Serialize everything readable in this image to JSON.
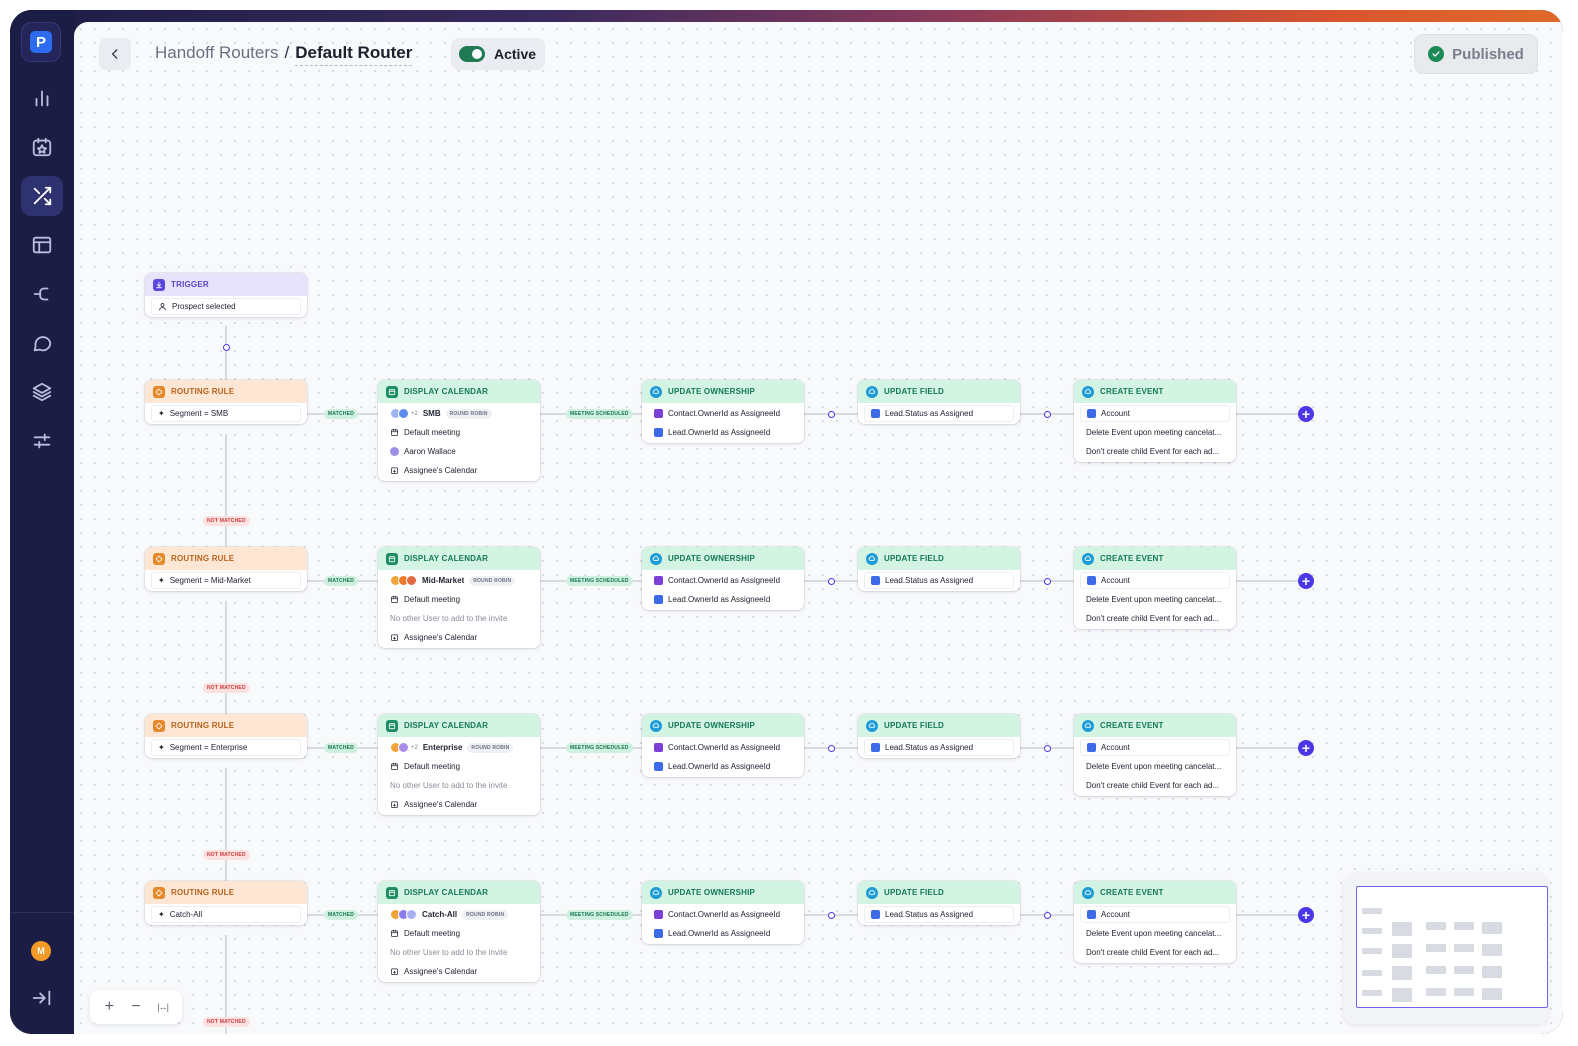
{
  "colors": {
    "sidebar_bg": "#1c1d44",
    "accent": "#4b37e8",
    "trigger_header": "#e7e3fb",
    "rule_header": "#fde7d4",
    "step_header": "#d3f3e3",
    "matched_badge": "#cdf0df",
    "not_matched_badge": "#fde0e0",
    "toggle_on": "#1f7a54"
  },
  "sidebar": {
    "logo": "P",
    "items": [
      {
        "icon": "bar-chart-icon"
      },
      {
        "icon": "calendar-star-icon"
      },
      {
        "icon": "shuffle-icon",
        "active": true
      },
      {
        "icon": "layout-icon"
      },
      {
        "icon": "branch-icon"
      },
      {
        "icon": "chat-icon"
      },
      {
        "icon": "layers-icon"
      },
      {
        "icon": "sliders-icon"
      }
    ],
    "avatar_initial": "M",
    "collapse_icon": "collapse-right-icon"
  },
  "header": {
    "breadcrumb_parent": "Handoff Routers",
    "breadcrumb_separator": "/",
    "breadcrumb_current": "Default Router",
    "status_label": "Active",
    "publish_label": "Published"
  },
  "labels": {
    "trigger_title": "TRIGGER",
    "trigger_value": "Prospect selected",
    "routing_rule": "ROUTING RULE",
    "display_calendar": "DISPLAY CALENDAR",
    "update_ownership": "UPDATE OWNERSHIP",
    "update_field": "UPDATE FIELD",
    "create_event": "CREATE EVENT",
    "matched": "MATCHED",
    "not_matched": "NOT MATCHED",
    "meeting_scheduled": "MEETING SCHEDULED",
    "round_robin": "ROUND ROBIN",
    "default_meeting": "Default meeting",
    "assignees_calendar": "Assignee's Calendar",
    "no_other_user": "No other User to add to the invite",
    "contact_owner": "Contact.OwnerId as AssigneeId",
    "lead_owner": "Lead.OwnerId as AssigneeId",
    "lead_status": "Lead.Status as Assigned",
    "account": "Account",
    "delete_event": "Delete Event upon meeting cancelat...",
    "no_child_event": "Don't create child Event for each ad...",
    "extra_count": "+2"
  },
  "routes": [
    {
      "rule": "Segment = SMB",
      "calendar_name": "SMB",
      "calendar_user": "Aaron Wallace",
      "extra": "+2"
    },
    {
      "rule": "Segment = Mid-Market",
      "calendar_name": "Mid-Market",
      "calendar_user": null
    },
    {
      "rule": "Segment = Enterprise",
      "calendar_name": "Enterprise",
      "calendar_user": null,
      "extra": "+2"
    },
    {
      "rule": "Catch-All",
      "calendar_name": "Catch-All",
      "calendar_user": null
    }
  ],
  "zoom": {
    "in": "+",
    "out": "−",
    "fit": "|↔|"
  }
}
